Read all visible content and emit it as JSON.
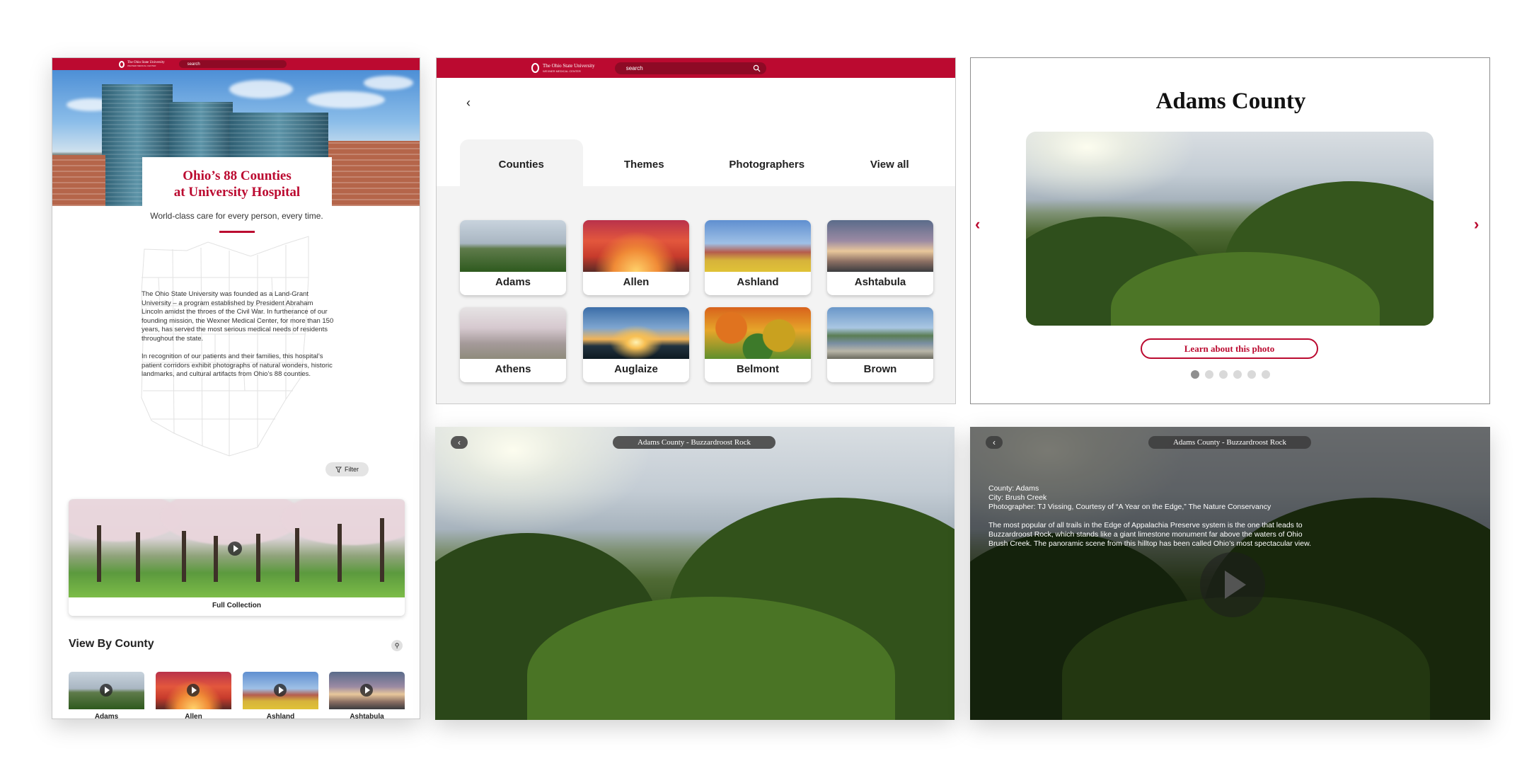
{
  "brand": {
    "university": "The Ohio State University",
    "subtitle": "WEXNER MEDICAL CENTER",
    "search_placeholder": "search",
    "accent": "#bb0a30"
  },
  "home": {
    "title_line1": "Ohio’s 88 Counties",
    "title_line2": "at University Hospital",
    "tagline": "World-class care for every person, every time.",
    "about_p1": "The Ohio State University was founded as a Land-Grant University – a program established by President Abraham Lincoln amidst the throes of the Civil War. In furtherance of our founding mission, the Wexner Medical Center, for more than 150 years, has served the most serious medical needs of residents throughout the state.",
    "about_p2": "In recognition of our patients and their families, this hospital’s patient corridors exhibit photographs of natural wonders, historic landmarks, and cultural artifacts from Ohio’s 88 counties.",
    "filter_label": "Filter",
    "full_collection_label": "Full Collection",
    "view_by_county_title": "View By County",
    "mini_counties": [
      "Adams",
      "Allen",
      "Ashland",
      "Ashtabula"
    ]
  },
  "browse": {
    "tabs": [
      "Counties",
      "Themes",
      "Photographers",
      "View all"
    ],
    "active_tab": "Counties",
    "counties": [
      "Adams",
      "Allen",
      "Ashland",
      "Ashtabula",
      "Athens",
      "Auglaize",
      "Belmont",
      "Brown"
    ]
  },
  "detail": {
    "county": "Adams County",
    "learn_button": "Learn about this photo",
    "dot_count": 6,
    "active_dot": 1
  },
  "fullscreen": {
    "title": "Adams County - Buzzardroost Rock",
    "county_line": "County: Adams",
    "city_line": "City: Brush Creek",
    "photographer_line": "Photographer: TJ Vissing, Courtesy of “A Year on the Edge,” The Nature Conservancy",
    "description": "The most popular of all trails in the Edge of Appalachia Preserve system is the one that leads to Buzzardroost Rock, which stands like a giant limestone monument far above the waters of Ohio Brush Creek. The panoramic scene from this hilltop has been called Ohio’s most spectacular view."
  }
}
